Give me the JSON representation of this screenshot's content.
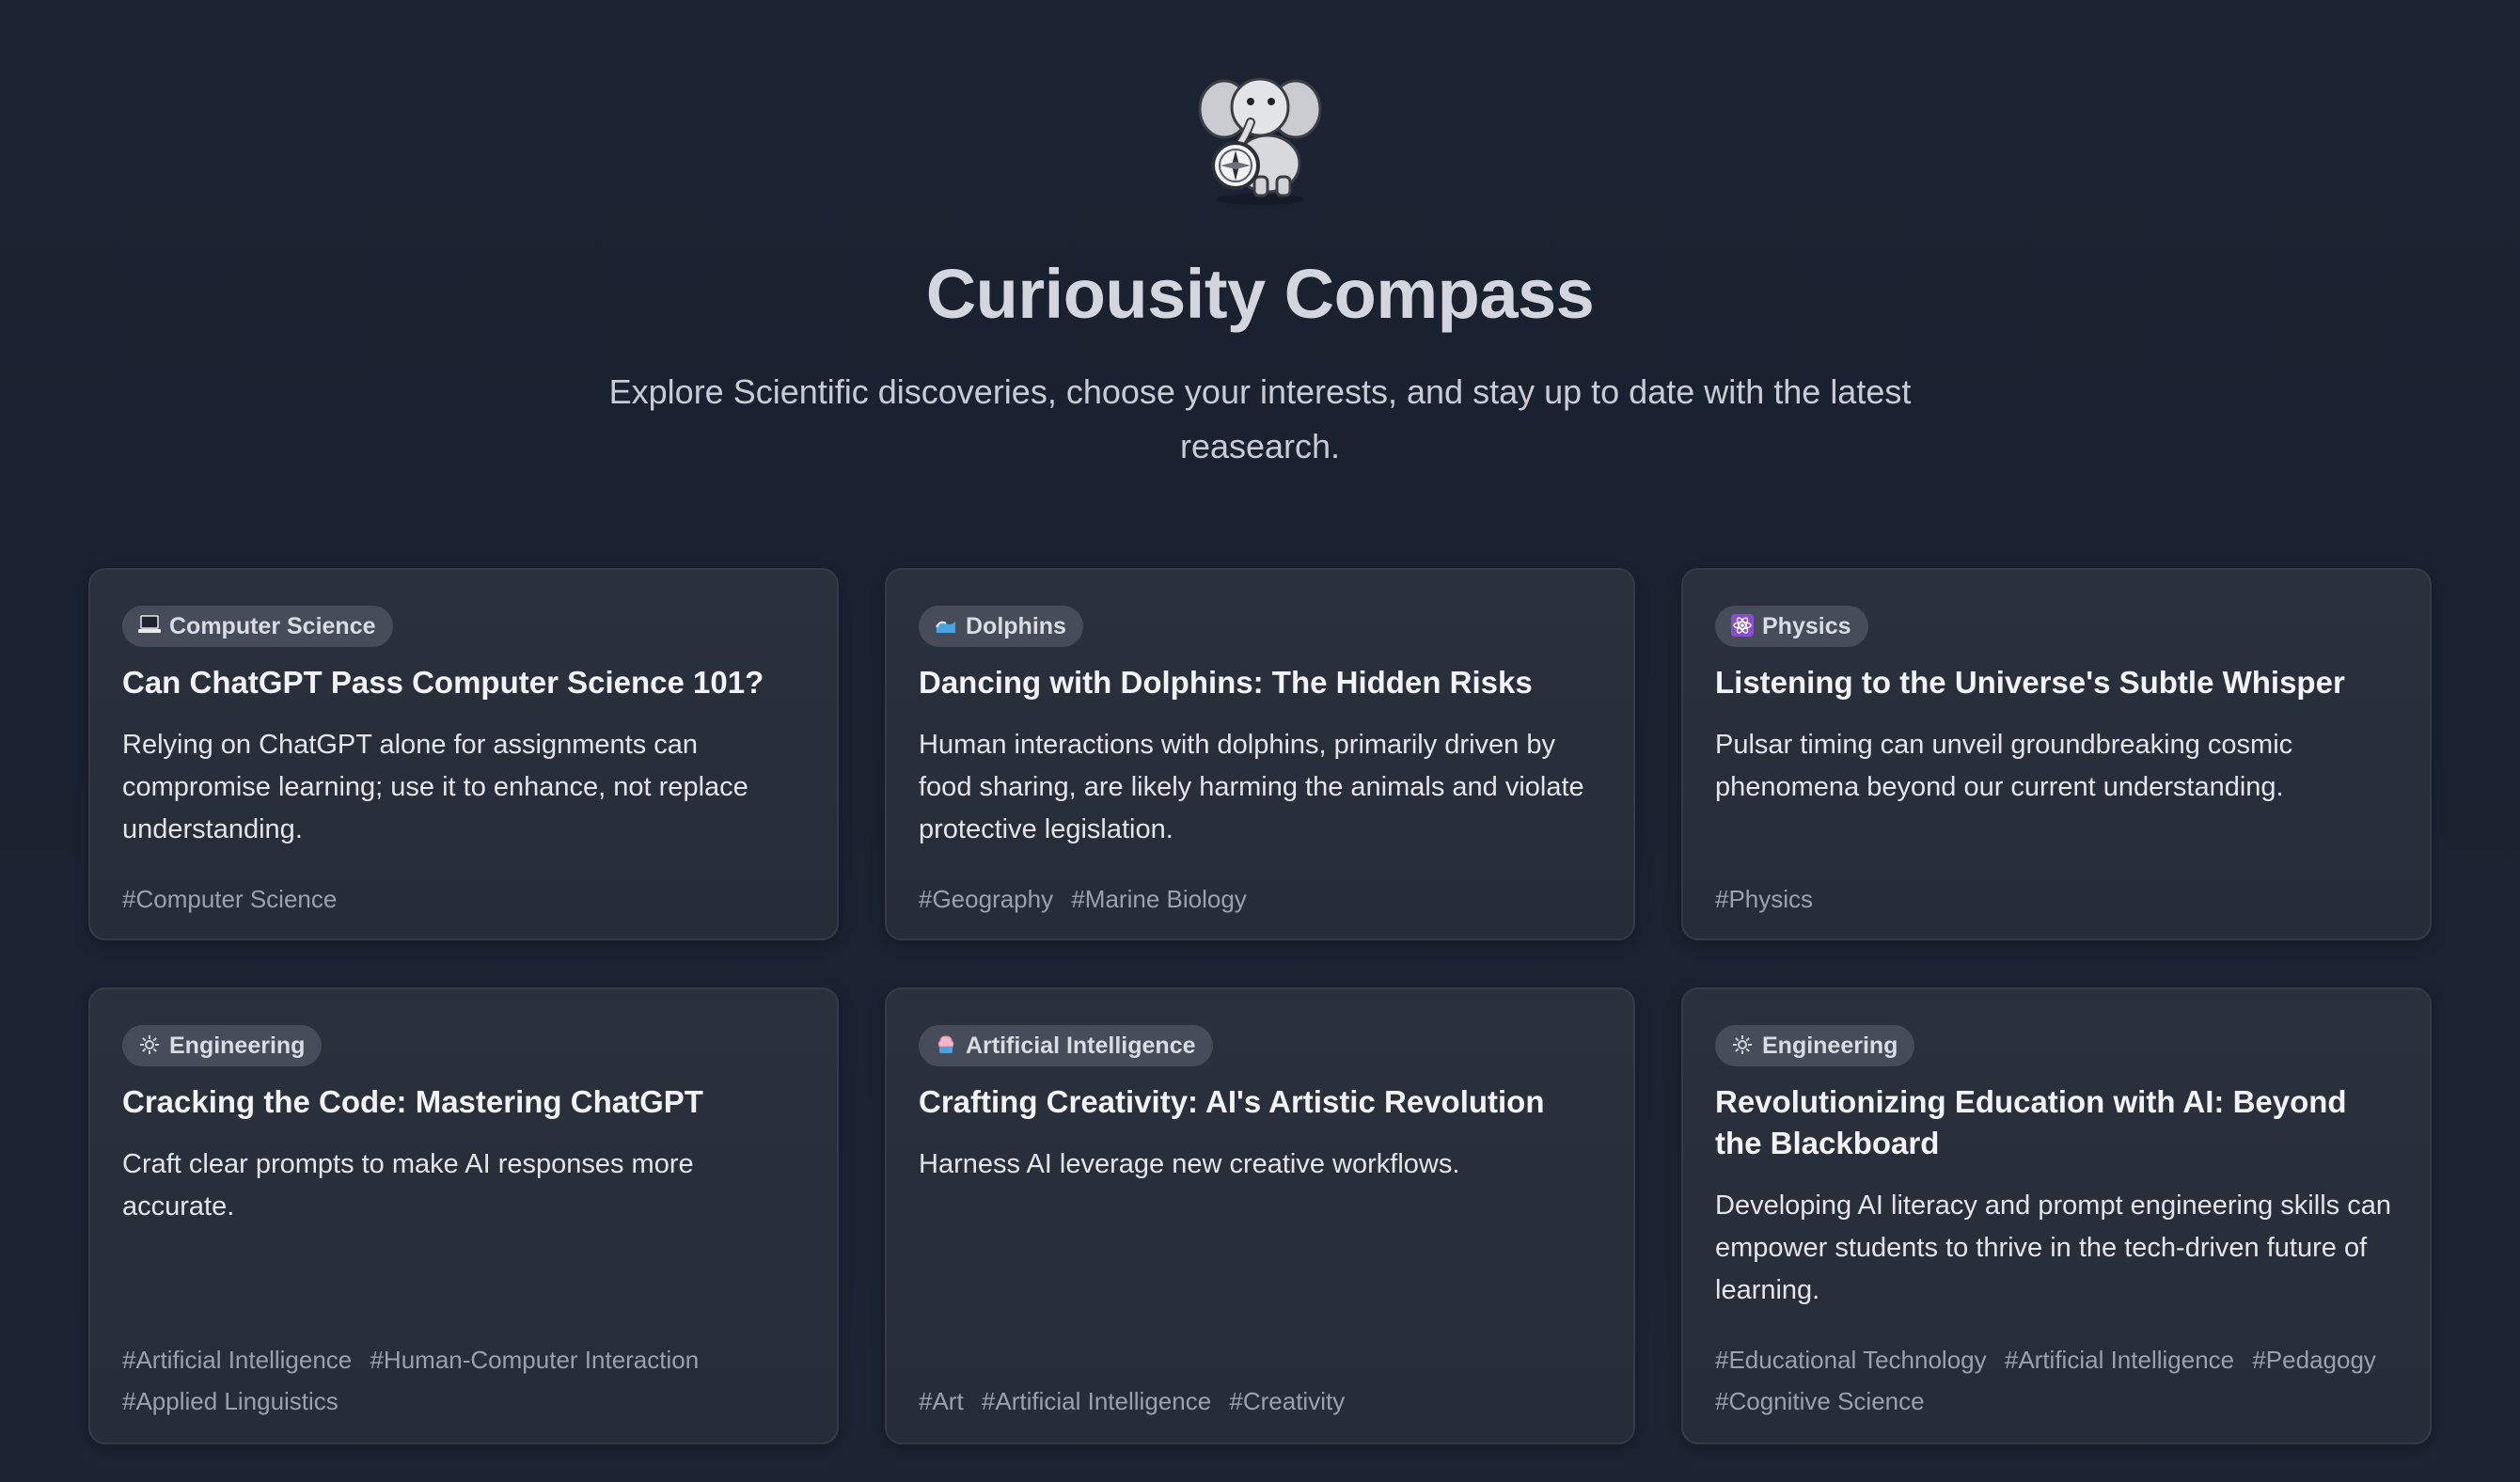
{
  "header": {
    "title": "Curiousity Compass",
    "subtitle": "Explore Scientific discoveries, choose your interests, and stay up to date with the latest reasearch.",
    "logo_icon": "elephant-compass-icon"
  },
  "cards": [
    {
      "category": "Computer Science",
      "category_icon": "laptop-icon",
      "title": "Can ChatGPT Pass Computer Science 101?",
      "description": "Relying on ChatGPT alone for assignments can compromise learning; use it to enhance, not replace understanding.",
      "tags": [
        "#Computer Science"
      ]
    },
    {
      "category": "Dolphins",
      "category_icon": "wave-icon",
      "title": "Dancing with Dolphins: The Hidden Risks",
      "description": "Human interactions with dolphins, primarily driven by food sharing, are likely harming the animals and violate protective legislation.",
      "tags": [
        "#Geography",
        "#Marine Biology"
      ]
    },
    {
      "category": "Physics",
      "category_icon": "atom-icon",
      "title": "Listening to the Universe's Subtle Whisper",
      "description": "Pulsar timing can unveil groundbreaking cosmic phenomena beyond our current understanding.",
      "tags": [
        "#Physics"
      ]
    },
    {
      "category": "Engineering",
      "category_icon": "gear-icon",
      "title": "Cracking the Code: Mastering ChatGPT",
      "description": "Craft clear prompts to make AI responses more accurate.",
      "tags": [
        "#Artificial Intelligence",
        "#Human-Computer Interaction",
        "#Applied Linguistics"
      ]
    },
    {
      "category": "Artificial Intelligence",
      "category_icon": "brain-icon",
      "title": "Crafting Creativity: AI's Artistic Revolution",
      "description": "Harness AI leverage new creative workflows.",
      "tags": [
        "#Art",
        "#Artificial Intelligence",
        "#Creativity"
      ]
    },
    {
      "category": "Engineering",
      "category_icon": "gear-icon",
      "title": "Revolutionizing Education with AI: Beyond the Blackboard",
      "description": "Developing AI literacy and prompt engineering skills can empower students to thrive in the tech-driven future of learning.",
      "tags": [
        "#Educational Technology",
        "#Artificial Intelligence",
        "#Pedagogy",
        "#Cognitive Science"
      ]
    }
  ]
}
